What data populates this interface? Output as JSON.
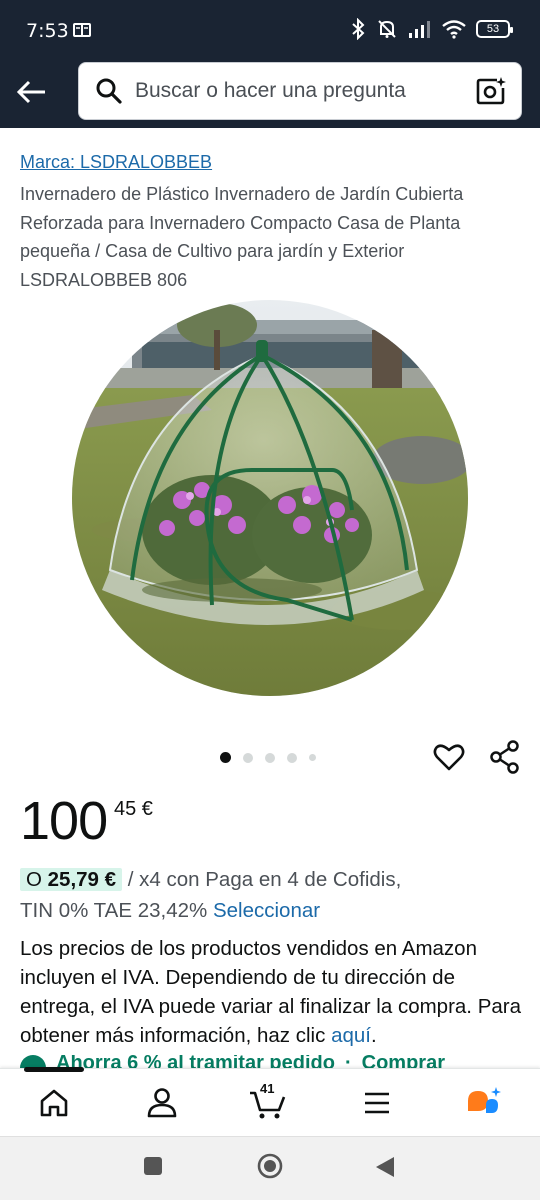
{
  "status_bar": {
    "time": "7:53",
    "battery": "53"
  },
  "search": {
    "placeholder": "Buscar o hacer una pregunta"
  },
  "product": {
    "brand": "Marca: LSDRALOBBEB",
    "title": "Invernadero de Plástico Invernadero de Jardín Cubierta Reforzada para Invernadero Compacto Casa de Planta pequeña / Casa de Cultivo para jardín y Exterior LSDRALOBBEB 806",
    "image_count": 5,
    "active_image": 1,
    "price_whole": "100",
    "price_fraction": "45 €",
    "installment_prefix": "O",
    "installment_amount": "25,79 €",
    "installment_text": "/ x4 con Paga en 4 de Cofidis,",
    "financing_terms": "TIN 0% TAE 23,42%",
    "financing_link": "Seleccionar",
    "vat_text": "Los precios de los productos vendidos en Amazon incluyen el IVA. Dependiendo de tu dirección de entrega, el IVA puede variar al finalizar la compra. Para obtener más información, haz clic",
    "vat_link": "aquí",
    "vat_end": ".",
    "savings_text": "Ahorra 6 % al tramitar pedido",
    "savings_link": "Comprar"
  },
  "bottom_nav": {
    "items": [
      "home-icon",
      "account-icon",
      "cart-icon",
      "menu-icon",
      "rufus-icon"
    ],
    "cart_count": "41"
  },
  "colors": {
    "header_bg": "#1a2433",
    "link": "#1c6aa9",
    "savings": "#067d62",
    "pill_bg": "#d7f4ea",
    "rufus_orange": "#ff7b1a",
    "rufus_blue": "#1a8cff"
  }
}
